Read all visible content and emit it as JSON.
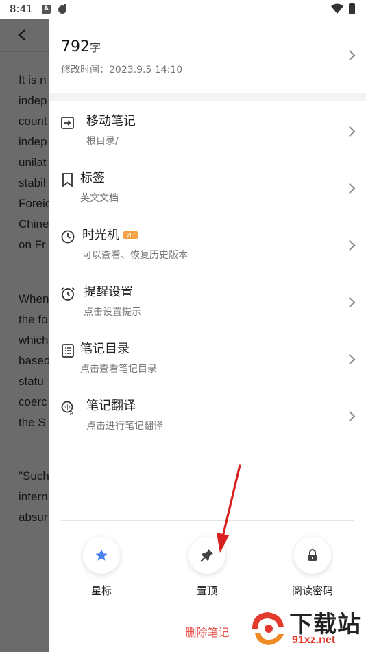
{
  "status_bar": {
    "time": "8:41",
    "a_icon_glyph": "A"
  },
  "background": {
    "lines_block1": [
      "It is n",
      "indep",
      "count",
      "indep",
      "unilat",
      "stabil",
      "Foreic",
      "Chine",
      "on Fr"
    ],
    "lines_block2": [
      "When",
      "the fo",
      "which",
      "based",
      "statu",
      "coerc",
      "the S"
    ],
    "lines_block3": [
      "\"Such",
      "intern",
      "absur"
    ]
  },
  "panel": {
    "word_count": "792",
    "word_unit": "字",
    "modified": "修改时间：2023.9.5 14:10",
    "items": [
      {
        "title": "移动笔记",
        "subtitle": "根目录/",
        "icon": "move-icon"
      },
      {
        "title": "标签",
        "subtitle": "英文文档",
        "icon": "tag-icon"
      },
      {
        "title": "时光机",
        "subtitle": "可以查看、恢复历史版本",
        "icon": "clock-icon",
        "badge": "VIP"
      },
      {
        "title": "提醒设置",
        "subtitle": "点击设置提示",
        "icon": "alarm-icon"
      },
      {
        "title": "笔记目录",
        "subtitle": "点击查看笔记目录",
        "icon": "list-icon"
      },
      {
        "title": "笔记翻译",
        "subtitle": "点击进行笔记翻译",
        "icon": "translate-icon"
      }
    ],
    "actions": [
      {
        "label": "星标",
        "icon": "star-icon"
      },
      {
        "label": "置顶",
        "icon": "pin-icon"
      },
      {
        "label": "阅读密码",
        "icon": "lock-icon"
      }
    ],
    "delete_label": "删除笔记"
  },
  "watermark": {
    "title": "下载站",
    "url": "91xz.net"
  },
  "colors": {
    "accent_blue": "#4a7ff0",
    "delete_red": "#e8504a",
    "vip_orange": "#f4a043",
    "arrow_red": "#d8211f"
  }
}
